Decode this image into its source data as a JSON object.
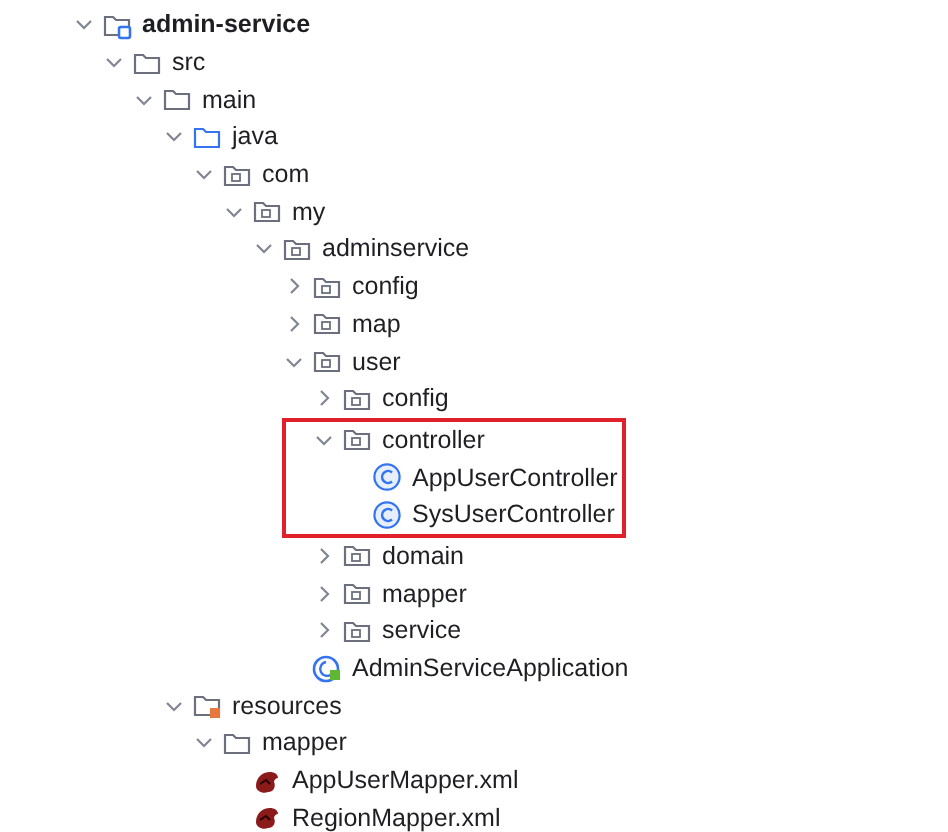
{
  "tree": [
    {
      "label": "admin-service",
      "kind": "module",
      "expanded": true,
      "children": [
        {
          "label": "src",
          "kind": "folder",
          "expanded": true,
          "children": [
            {
              "label": "main",
              "kind": "folder",
              "expanded": true,
              "children": [
                {
                  "label": "java",
                  "kind": "source",
                  "expanded": true,
                  "children": [
                    {
                      "label": "com",
                      "kind": "package",
                      "expanded": true,
                      "children": [
                        {
                          "label": "my",
                          "kind": "package",
                          "expanded": true,
                          "children": [
                            {
                              "label": "adminservice",
                              "kind": "package",
                              "expanded": true,
                              "children": [
                                {
                                  "label": "config",
                                  "kind": "package",
                                  "expanded": false
                                },
                                {
                                  "label": "map",
                                  "kind": "package",
                                  "expanded": false
                                },
                                {
                                  "label": "user",
                                  "kind": "package",
                                  "expanded": true,
                                  "children": [
                                    {
                                      "label": "config",
                                      "kind": "package",
                                      "expanded": false
                                    },
                                    {
                                      "label": "controller",
                                      "kind": "package",
                                      "expanded": true,
                                      "highlighted": true,
                                      "children": [
                                        {
                                          "label": "AppUserController",
                                          "kind": "class"
                                        },
                                        {
                                          "label": "SysUserController",
                                          "kind": "class"
                                        }
                                      ]
                                    },
                                    {
                                      "label": "domain",
                                      "kind": "package",
                                      "expanded": false
                                    },
                                    {
                                      "label": "mapper",
                                      "kind": "package",
                                      "expanded": false
                                    },
                                    {
                                      "label": "service",
                                      "kind": "package",
                                      "expanded": false
                                    }
                                  ]
                                },
                                {
                                  "label": "AdminServiceApplication",
                                  "kind": "app"
                                }
                              ]
                            }
                          ]
                        }
                      ]
                    }
                  ]
                },
                {
                  "label": "resources",
                  "kind": "resources",
                  "expanded": true,
                  "children": [
                    {
                      "label": "mapper",
                      "kind": "folder",
                      "expanded": true,
                      "children": [
                        {
                          "label": "AppUserMapper.xml",
                          "kind": "xml"
                        },
                        {
                          "label": "RegionMapper.xml",
                          "kind": "xml"
                        }
                      ]
                    }
                  ]
                }
              ]
            }
          ]
        }
      ]
    }
  ]
}
